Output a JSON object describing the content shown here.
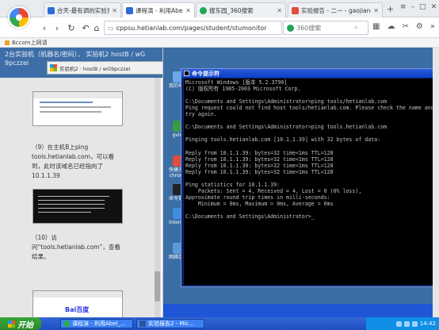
{
  "browser": {
    "tabs": [
      {
        "label": "合天-最有调的实验室",
        "icon_color": "#2f6bd8",
        "active": false
      },
      {
        "label": "课程演 - 利用Abel_CaixB",
        "icon_color": "#2f6bd8",
        "active": true
      },
      {
        "label": "搜东园_360搜索",
        "icon_color": "#21a557",
        "active": false
      },
      {
        "label": "实验报告 - 二一 - gaojiangq",
        "icon_color": "#e24c3c",
        "active": false
      }
    ],
    "new_tab": "+",
    "window_controls": [
      "≡",
      "–",
      "□",
      "✕"
    ],
    "url": "cppsu.hetianlab.com/pages/student/stumonitor",
    "search_placeholder": "360搜索",
    "bookmarks_label": "Bccom上网请"
  },
  "left_pane": {
    "header_line1": "2台实验机（机器名/密码）， 实验机2  hostB / wG",
    "header_line2": "9pczzei",
    "remote_bar_label": "实验机2 · hostB / wG9pczzei",
    "step9": "（9）在主机B上ping tools.hetianlab.com，可以看到，此时该域名已经指向了10.1.1.39",
    "step10": "（10）访问“tools.hetianlab.com”，查看结果。",
    "baidu_text": "Bai百度"
  },
  "desktop_icons": [
    {
      "label": "我的电脑",
      "color": "#6aa8e8"
    },
    {
      "label": "gvim",
      "color": "#3c9a45"
    },
    {
      "label": "快捷方式 chrome",
      "color": "#e24c3c"
    },
    {
      "label": "命令提示",
      "color": "#222222"
    },
    {
      "label": "Internet",
      "color": "#3f8fe0"
    },
    {
      "label": "网络连接",
      "color": "#5b9bd5"
    }
  ],
  "cmd": {
    "title": "命令提示符",
    "lines": [
      "Microsoft Windows [版本 5.2.3790]",
      "(C) 版权所有 1985-2003 Microsoft Corp.",
      "",
      "C:\\Documents and Settings\\Administrator>ping tools/hetianlab.com",
      "Ping request could not find host tools/hetianlab.com. Please check the name and",
      "try again.",
      "",
      "C:\\Documents and Settings\\Administrator>ping tools.hetianlab.com",
      "",
      "Pinging tools.hetianlab.com [10.1.1.39] with 32 bytes of data:",
      "",
      "Reply from 10.1.1.39: bytes=32 time<1ms TTL=128",
      "Reply from 10.1.1.39: bytes=32 time<1ms TTL=128",
      "Reply from 10.1.1.39: bytes=32 time<1ms TTL=128",
      "Reply from 10.1.1.39: bytes=32 time<1ms TTL=128",
      "",
      "Ping statistics for 10.1.1.39:",
      "    Packets: Sent = 4, Received = 4, Lost = 0 (0% loss),",
      "Approximate round trip times in milli-seconds:",
      "    Minimum = 0ms, Maximum = 0ms, Average = 0ms",
      "",
      "C:\\Documents and Settings\\Administrator>_"
    ]
  },
  "taskbar": {
    "start_label": "开始",
    "items": [
      {
        "label": "课程演 - 利用Abel_...",
        "active": false
      },
      {
        "label": "实验报告2 - Mic...",
        "active": false
      }
    ],
    "clock": "14:42"
  }
}
